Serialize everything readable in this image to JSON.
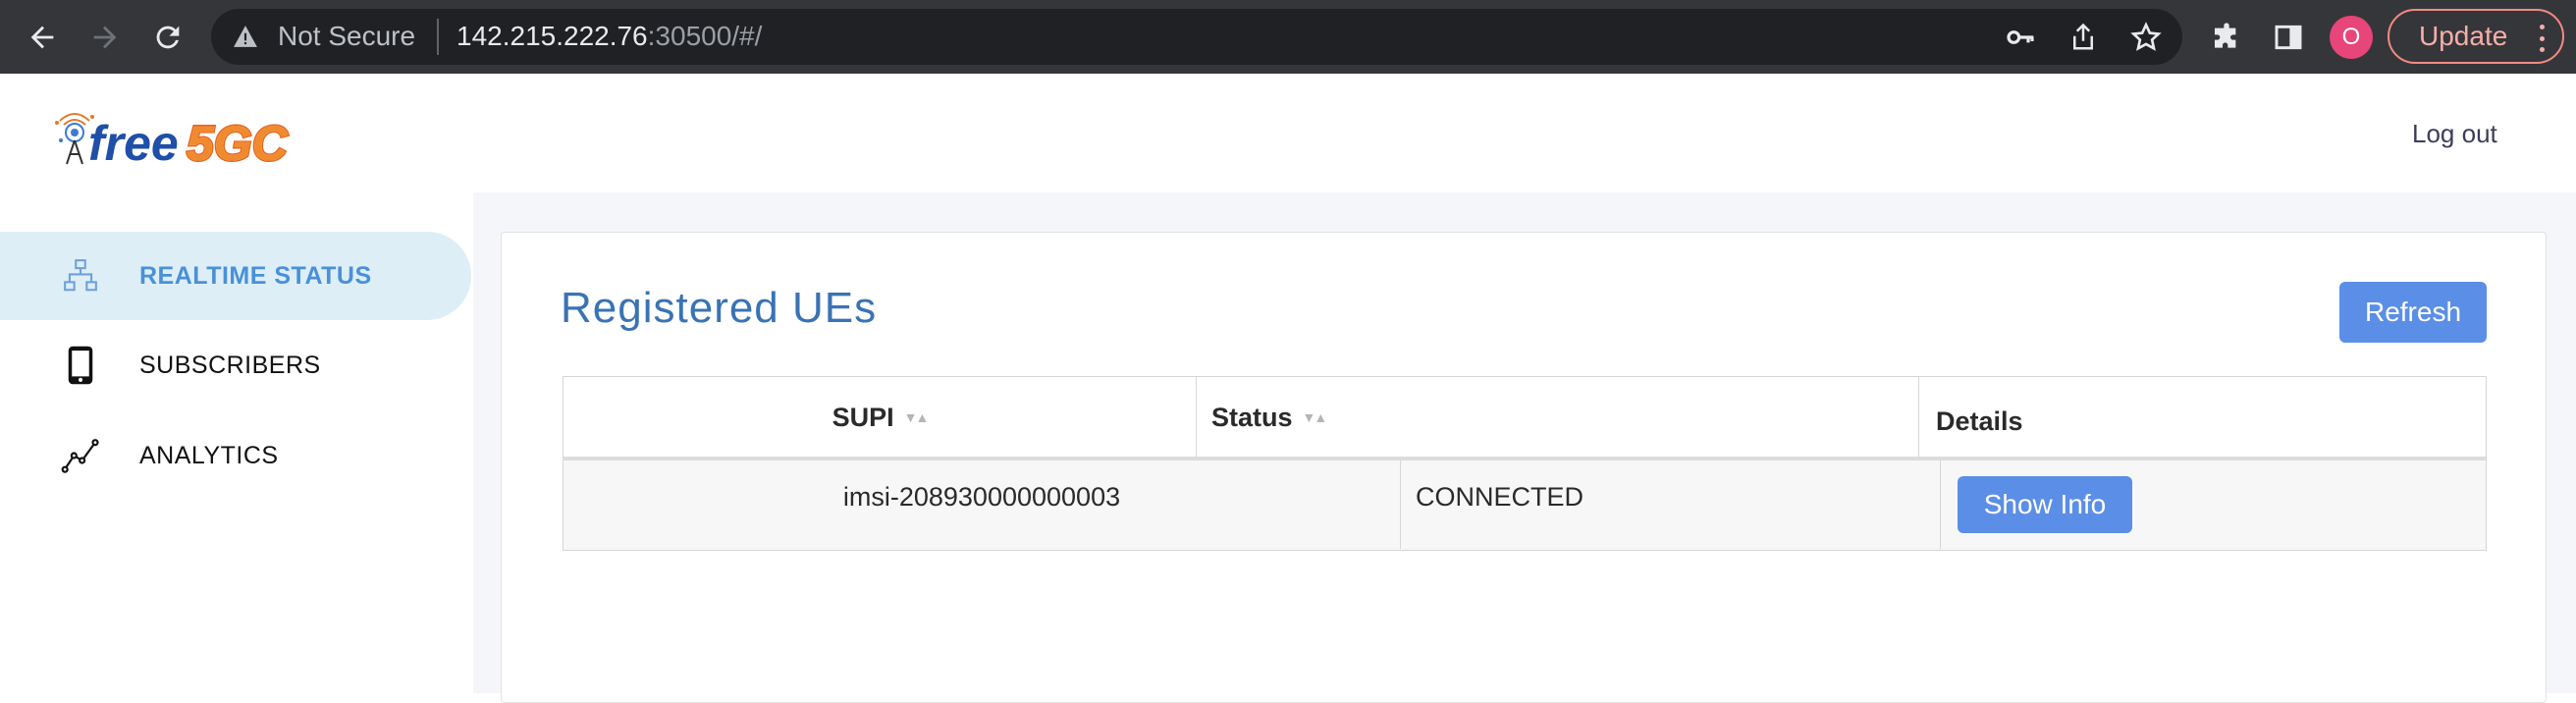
{
  "browser": {
    "security_label": "Not Secure",
    "url_host": "142.215.222.76",
    "url_rest": ":30500/#/",
    "profile_initial": "O",
    "update_label": "Update"
  },
  "header": {
    "logo_text": "free5GC",
    "logout_label": "Log out"
  },
  "sidebar": {
    "items": [
      {
        "label": "REALTIME STATUS",
        "icon": "network-icon",
        "active": true
      },
      {
        "label": "SUBSCRIBERS",
        "icon": "phone-icon",
        "active": false
      },
      {
        "label": "ANALYTICS",
        "icon": "line-chart-icon",
        "active": false
      }
    ]
  },
  "main": {
    "title": "Registered UEs",
    "refresh_label": "Refresh",
    "table": {
      "columns": [
        "SUPI",
        "Status",
        "Details"
      ],
      "rows": [
        {
          "supi": "imsi-208930000000003",
          "status": "CONNECTED",
          "action": "Show Info"
        }
      ]
    }
  },
  "colors": {
    "accent": "#5b8ee6",
    "title": "#3a73b3",
    "active_nav_bg": "#ddeef7",
    "active_nav_text": "#4a90d9",
    "chrome": "#35363a"
  }
}
